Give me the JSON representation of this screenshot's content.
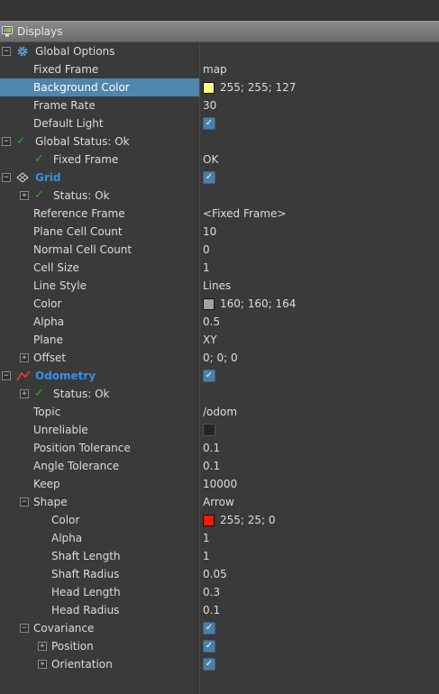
{
  "panel": {
    "title": "Displays"
  },
  "colors": {
    "selection": "#4f86ad",
    "link": "#3a8ee6",
    "ok": "#2fa82f"
  },
  "global_options": {
    "label": "Global Options",
    "fixed_frame": {
      "label": "Fixed Frame",
      "value": "map"
    },
    "background_color": {
      "label": "Background Color",
      "value": "255; 255; 127",
      "swatch": "#ffff7f"
    },
    "frame_rate": {
      "label": "Frame Rate",
      "value": "30"
    },
    "default_light": {
      "label": "Default Light",
      "checked": true
    }
  },
  "global_status": {
    "label": "Global Status: Ok",
    "fixed_frame": {
      "label": "Fixed Frame",
      "value": "OK"
    }
  },
  "grid": {
    "label": "Grid",
    "checked": true,
    "status": "Status: Ok",
    "reference_frame": {
      "label": "Reference Frame",
      "value": "<Fixed Frame>"
    },
    "plane_cell_count": {
      "label": "Plane Cell Count",
      "value": "10"
    },
    "normal_cell_count": {
      "label": "Normal Cell Count",
      "value": "0"
    },
    "cell_size": {
      "label": "Cell Size",
      "value": "1"
    },
    "line_style": {
      "label": "Line Style",
      "value": "Lines"
    },
    "color": {
      "label": "Color",
      "value": "160; 160; 164",
      "swatch": "#a0a0a4"
    },
    "alpha": {
      "label": "Alpha",
      "value": "0.5"
    },
    "plane": {
      "label": "Plane",
      "value": "XY"
    },
    "offset": {
      "label": "Offset",
      "value": "0; 0; 0"
    }
  },
  "odometry": {
    "label": "Odometry",
    "checked": true,
    "status": "Status: Ok",
    "topic": {
      "label": "Topic",
      "value": "/odom"
    },
    "unreliable": {
      "label": "Unreliable",
      "checked": false
    },
    "position_tolerance": {
      "label": "Position Tolerance",
      "value": "0.1"
    },
    "angle_tolerance": {
      "label": "Angle Tolerance",
      "value": "0.1"
    },
    "keep": {
      "label": "Keep",
      "value": "10000"
    },
    "shape": {
      "label": "Shape",
      "value": "Arrow",
      "color": {
        "label": "Color",
        "value": "255; 25; 0",
        "swatch": "#ff1900"
      },
      "alpha": {
        "label": "Alpha",
        "value": "1"
      },
      "shaft_length": {
        "label": "Shaft Length",
        "value": "1"
      },
      "shaft_radius": {
        "label": "Shaft Radius",
        "value": "0.05"
      },
      "head_length": {
        "label": "Head Length",
        "value": "0.3"
      },
      "head_radius": {
        "label": "Head Radius",
        "value": "0.1"
      }
    },
    "covariance": {
      "label": "Covariance",
      "checked": true,
      "position": {
        "label": "Position",
        "checked": true
      },
      "orientation": {
        "label": "Orientation",
        "checked": true
      }
    }
  }
}
